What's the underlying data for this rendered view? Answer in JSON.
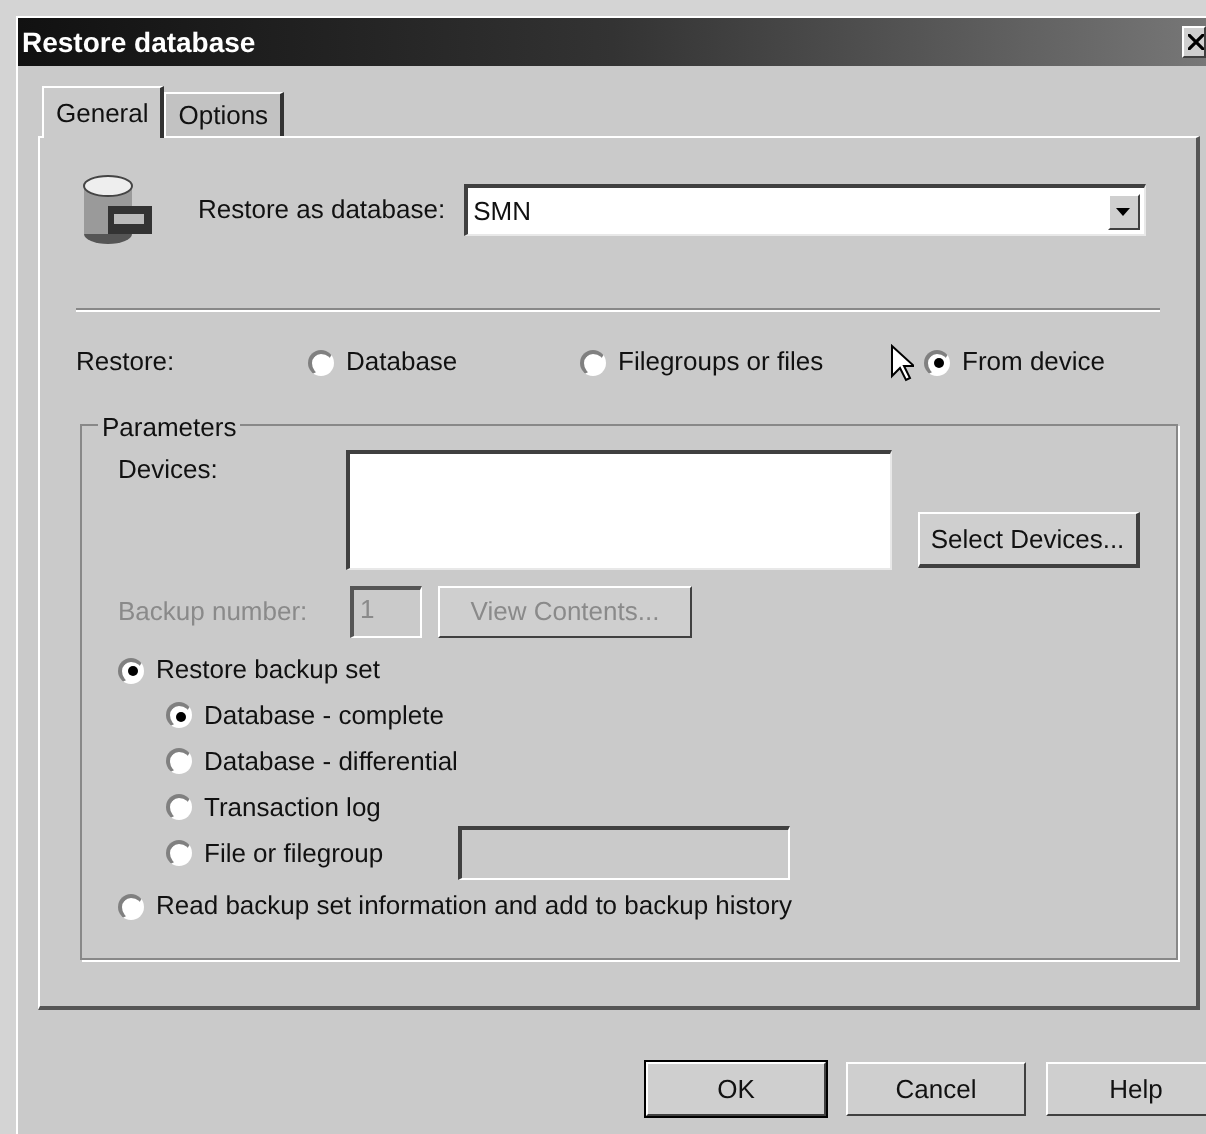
{
  "window": {
    "title": "Restore database"
  },
  "tabs": [
    {
      "label": "General",
      "selected": true
    },
    {
      "label": "Options",
      "selected": false
    }
  ],
  "restore_as": {
    "label": "Restore as database:",
    "value": "SMN"
  },
  "restore": {
    "label": "Restore:",
    "options": [
      {
        "label": "Database",
        "selected": false
      },
      {
        "label": "Filegroups or files",
        "selected": false
      },
      {
        "label": "From device",
        "selected": true
      }
    ]
  },
  "parameters": {
    "title": "Parameters",
    "devices_label": "Devices:",
    "select_devices": "Select Devices...",
    "backup_number": {
      "label": "Backup number:",
      "value": "1",
      "disabled": true
    },
    "view_contents": {
      "label": "View Contents...",
      "disabled": true
    },
    "options": [
      {
        "label": "Restore backup set",
        "selected": true,
        "children": [
          {
            "label": "Database - complete",
            "selected": true
          },
          {
            "label": "Database - differential",
            "selected": false
          },
          {
            "label": "Transaction log",
            "selected": false
          },
          {
            "label": "File or filegroup",
            "selected": false,
            "kind": "field"
          }
        ]
      },
      {
        "label": "Read backup set information and add to backup history",
        "selected": false
      }
    ]
  },
  "buttons": [
    {
      "label": "OK",
      "default": true
    },
    {
      "label": "Cancel",
      "default": false
    },
    {
      "label": "Help",
      "default": false
    }
  ]
}
